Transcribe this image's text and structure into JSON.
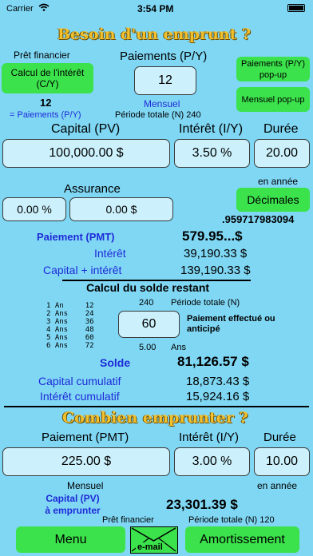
{
  "status": {
    "carrier": "Carrier",
    "time": "3:54 PM"
  },
  "section1": {
    "title": "Besoin d'un emprunt ?",
    "pret_label": "Prêt financier",
    "calc_button": "Calcul de l'intérêt (C/Y)",
    "cy_value": "12",
    "cy_note": "= Paiements (P/Y)",
    "paiements_label": "Paiements (P/Y)",
    "paiements_value": "12",
    "mensuel": "Mensuel",
    "periode_label": "Période totale (N) 240",
    "popup1": "Paiements (P/Y) pop-up",
    "popup2": "Mensuel pop-up",
    "capital_label": "Capital (PV)",
    "interet_label": "Intérêt (I/Y)",
    "duree_label": "Durée",
    "capital_value": "100,000.00 $",
    "interet_value": "3.50 %",
    "duree_value": "20.00",
    "en_annee": "en année",
    "assurance_label": "Assurance",
    "assurance_pct": "0.00 %",
    "assurance_amt": "0.00 $",
    "decimales": "Décimales",
    "decimal_digits": ".959717983094",
    "pmt_label": "Paiement (PMT)",
    "pmt_value": "579.95...$",
    "interet_row_label": "Intérêt",
    "interet_row_value": "39,190.33 $",
    "ci_label": "Capital + intérêt",
    "ci_value": "139,190.33 $"
  },
  "solde": {
    "heading": "Calcul du solde restant",
    "schedule": "1 An     12\n2 Ans    24\n3 Ans    36\n4 Ans    48\n5 Ans    60\n6 Ans    72",
    "total_n": "240",
    "periode_label": "Période totale (N)",
    "paid_value": "60",
    "paid_label": "Paiement effectué ou anticipé",
    "years_value": "5.00",
    "years_unit": "Ans",
    "solde_label": "Solde",
    "solde_value": "81,126.57 $",
    "capital_cum_label": "Capital cumulatif",
    "capital_cum_value": "18,873.43 $",
    "interet_cum_label": "Intérêt cumulatif",
    "interet_cum_value": "15,924.16 $"
  },
  "section2": {
    "title": "Combien emprunter ?",
    "pmt_label": "Paiement (PMT)",
    "interet_label": "Intérêt (I/Y)",
    "duree_label": "Durée",
    "pmt_value": "225.00 $",
    "interet_value": "3.00 %",
    "duree_value": "10.00",
    "mensuel": "Mensuel",
    "en_annee": "en année",
    "capital_label": "Capital (PV) à emprunter",
    "capital_value": "23,301.39 $",
    "pret_label": "Prêt financier",
    "periode_label": "Période totale (N) 120"
  },
  "toolbar": {
    "menu": "Menu",
    "email": "e-mail",
    "amort": "Amortissement"
  },
  "colors": {
    "background": "#7fd7f4",
    "button": "#3be24b",
    "field": "#ccf1fc",
    "accent_blue": "#1f2ad8",
    "title_gold": "#f2c12e"
  }
}
